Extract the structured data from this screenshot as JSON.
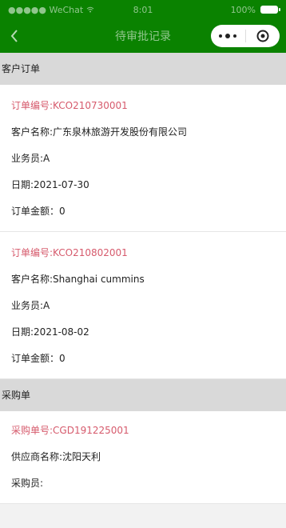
{
  "status_bar": {
    "carrier": "●●●●● WeChat",
    "time": "8:01",
    "battery": "100%"
  },
  "nav": {
    "title": "待审批记录"
  },
  "sections": {
    "customer_orders": "客户订单",
    "purchase_orders": "采购单"
  },
  "orders": [
    {
      "code": "订单编号:KCO210730001",
      "customer": "客户名称:广东泉林旅游开发股份有限公司",
      "salesman": "业务员:A",
      "date": "日期:2021-07-30",
      "amount": "订单金额：0"
    },
    {
      "code": "订单编号:KCO210802001",
      "customer": "客户名称:Shanghai cummins",
      "salesman": "业务员:A",
      "date": "日期:2021-08-02",
      "amount": "订单金额：0"
    }
  ],
  "purchases": [
    {
      "code": "采购单号:CGD191225001",
      "supplier": "供应商名称:沈阳天利",
      "buyer": "采购员:"
    }
  ],
  "colors": {
    "header": "#0a8200",
    "code_text": "#d65a6c",
    "section_bg": "#d9d9d9"
  },
  "icons": {
    "back": "chevron-left-icon",
    "more": "more-dots-icon",
    "close": "target-close-icon",
    "wifi": "wifi-icon",
    "battery": "battery-icon"
  }
}
